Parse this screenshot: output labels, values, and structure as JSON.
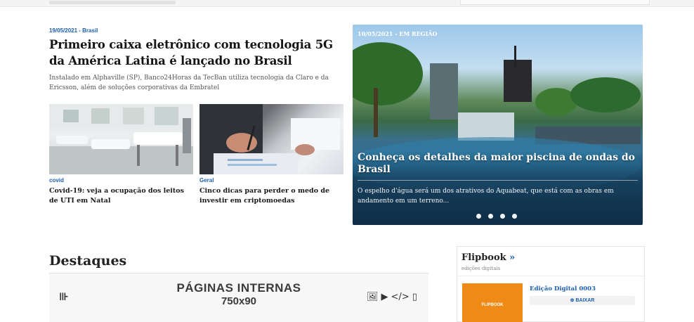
{
  "main_story": {
    "kicker": "19/05/2021 - Brasil",
    "title": "Primeiro caixa eletrônico com tecnologia 5G da América Latina é lançado no Brasil",
    "summary": "Instalado em Alphaville (SP), Banco24Horas da TecBan utiliza tecnologia da Claro e da Ericsson, além de soluções corporativas da Embratel"
  },
  "cards": [
    {
      "category": "covid",
      "title": "Covid-19: veja a ocupação dos leitos de UTI em Natal"
    },
    {
      "category": "Geral",
      "title": "Cinco dicas para perder o medo de investir em criptomoedas"
    }
  ],
  "hero": {
    "date": "10/05/2021 - EM REGIÃO",
    "title": "Conheça os detalhes da maior piscina de ondas do Brasil",
    "summary": "O espelho d'água será um dos atrativos do Aquabeat, que está com as obras em andamento em um terreno...",
    "slides": 4
  },
  "destaques": {
    "title": "Destaques",
    "ad_line1": "PÁGINAS INTERNAS",
    "ad_line2": "750x90"
  },
  "flipbook": {
    "title": "Flipbook",
    "arrow": "»",
    "subtitle": "edições digitais",
    "cover_text": "FLIPBOOK",
    "edition": "Edição Digital 0003",
    "download": "BAIXAR"
  },
  "colors": {
    "link_blue": "#1d5fae",
    "cover_orange": "#f08a17"
  }
}
